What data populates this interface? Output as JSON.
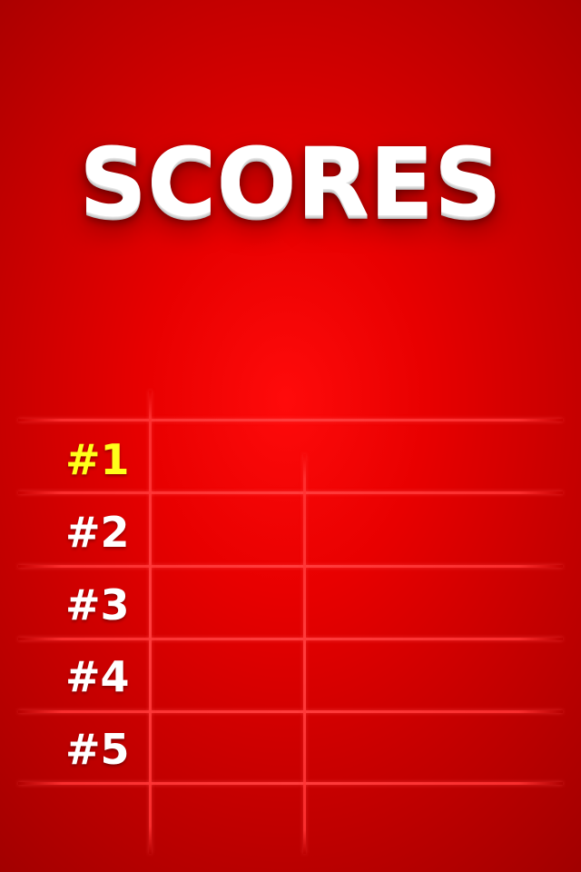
{
  "title": "SCORES",
  "rows": [
    {
      "rank": "#1",
      "name": "",
      "score": ""
    },
    {
      "rank": "#2",
      "name": "",
      "score": ""
    },
    {
      "rank": "#3",
      "name": "",
      "score": ""
    },
    {
      "rank": "#4",
      "name": "",
      "score": ""
    },
    {
      "rank": "#5",
      "name": "",
      "score": ""
    }
  ],
  "colors": {
    "background": "#e00000",
    "grid": "#ff3c3c",
    "highlight": "#ffff1a",
    "text": "#ffffff"
  }
}
